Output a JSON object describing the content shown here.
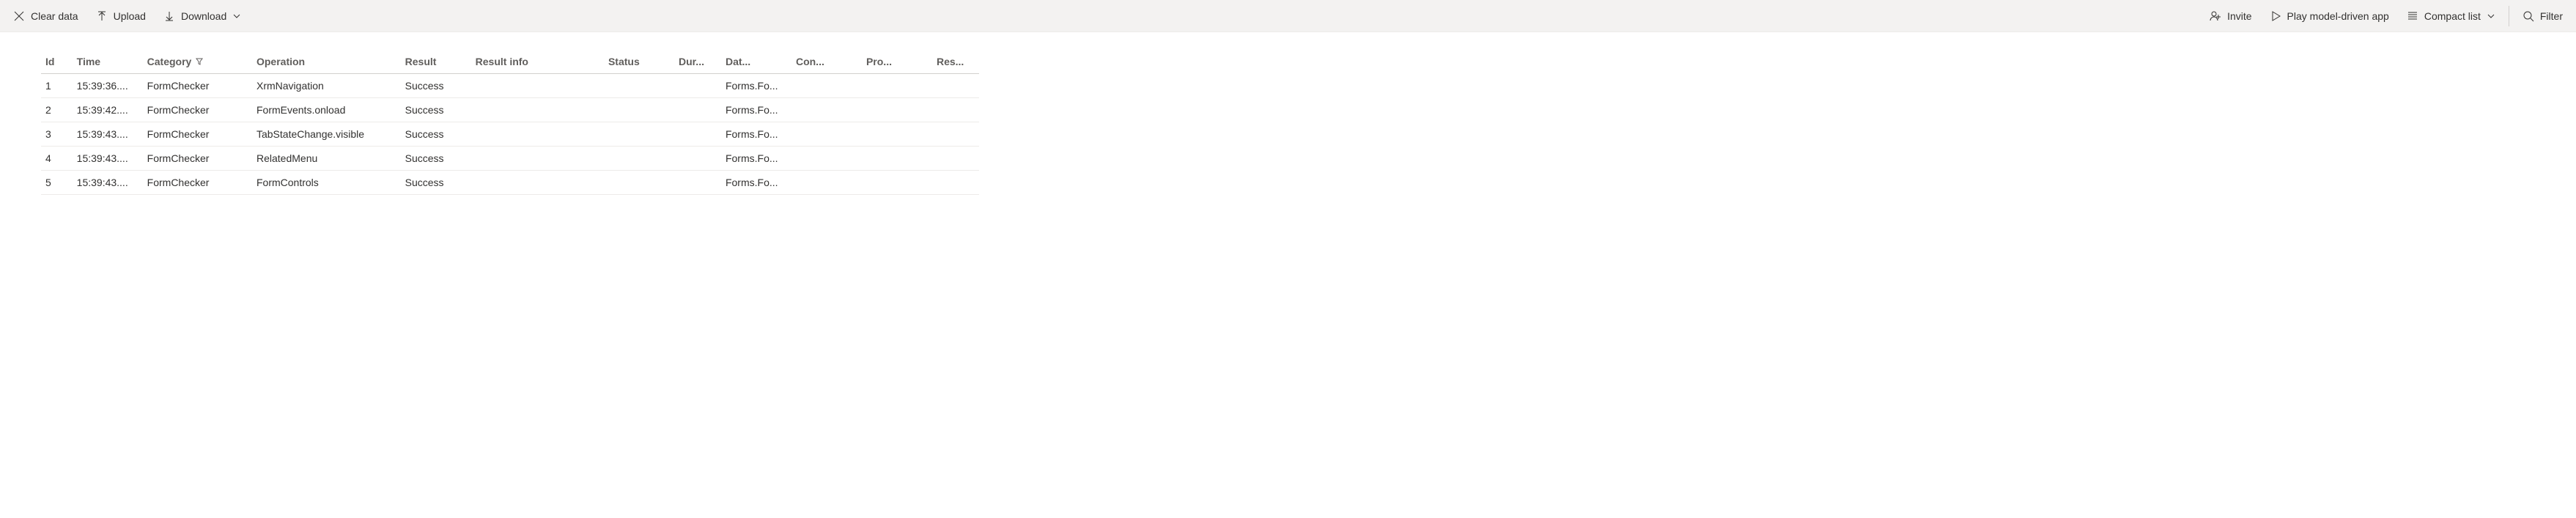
{
  "toolbar": {
    "clear_data": "Clear data",
    "upload": "Upload",
    "download": "Download",
    "invite": "Invite",
    "play": "Play model-driven app",
    "compact_list": "Compact list",
    "filter": "Filter"
  },
  "columns": {
    "id": "Id",
    "time": "Time",
    "category": "Category",
    "operation": "Operation",
    "result": "Result",
    "result_info": "Result info",
    "status": "Status",
    "duration": "Dur...",
    "data": "Dat...",
    "context": "Con...",
    "process": "Pro...",
    "resource": "Res..."
  },
  "rows": [
    {
      "id": "1",
      "time": "15:39:36....",
      "category": "FormChecker",
      "operation": "XrmNavigation",
      "result": "Success",
      "result_info": "",
      "status": "",
      "duration": "",
      "data": "Forms.Fo...",
      "context": "",
      "process": "",
      "resource": ""
    },
    {
      "id": "2",
      "time": "15:39:42....",
      "category": "FormChecker",
      "operation": "FormEvents.onload",
      "result": "Success",
      "result_info": "",
      "status": "",
      "duration": "",
      "data": "Forms.Fo...",
      "context": "",
      "process": "",
      "resource": ""
    },
    {
      "id": "3",
      "time": "15:39:43....",
      "category": "FormChecker",
      "operation": "TabStateChange.visible",
      "result": "Success",
      "result_info": "",
      "status": "",
      "duration": "",
      "data": "Forms.Fo...",
      "context": "",
      "process": "",
      "resource": ""
    },
    {
      "id": "4",
      "time": "15:39:43....",
      "category": "FormChecker",
      "operation": "RelatedMenu",
      "result": "Success",
      "result_info": "",
      "status": "",
      "duration": "",
      "data": "Forms.Fo...",
      "context": "",
      "process": "",
      "resource": ""
    },
    {
      "id": "5",
      "time": "15:39:43....",
      "category": "FormChecker",
      "operation": "FormControls",
      "result": "Success",
      "result_info": "",
      "status": "",
      "duration": "",
      "data": "Forms.Fo...",
      "context": "",
      "process": "",
      "resource": ""
    }
  ]
}
